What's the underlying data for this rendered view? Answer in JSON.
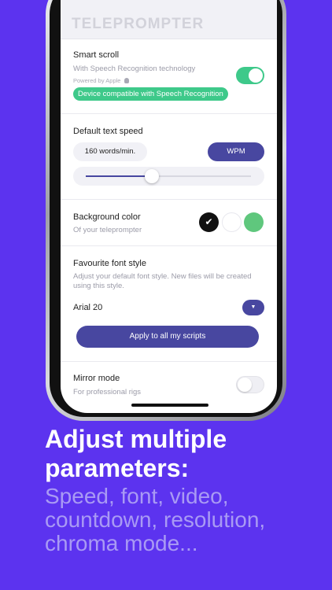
{
  "app": {
    "title": "TELEPROMPTER"
  },
  "smart_scroll": {
    "label": "Smart scroll",
    "subtitle": "With Speech Recognition technology",
    "powered_by": "Powered by Apple",
    "enabled": true,
    "badge": "Device compatible with Speech Recognition"
  },
  "text_speed": {
    "label": "Default text speed",
    "value_display": "160 words/min.",
    "unit_button": "WPM",
    "slider_fraction": 0.4
  },
  "background_color": {
    "label": "Background color",
    "subtitle": "Of your teleprompter",
    "selected_mark": "✔",
    "options": [
      "#111111",
      "#ffffff",
      "#5fc77d"
    ],
    "selected_index": 0
  },
  "font_style": {
    "label": "Favourite font style",
    "description": "Adjust your default font style. New files will be created using this style.",
    "current": "Arial 20",
    "dropdown_glyph": "▼",
    "apply_button": "Apply to all my scripts"
  },
  "mirror_mode": {
    "label": "Mirror mode",
    "subtitle": "For professional rigs",
    "enabled": false
  },
  "marketing": {
    "headline": "Adjust multiple parameters:",
    "subline": "Speed, font, video, countdown, resolution, chroma mode..."
  },
  "colors": {
    "background": "#5c33ef",
    "accent_blue": "#4847a0",
    "accent_green": "#3ec98a"
  }
}
